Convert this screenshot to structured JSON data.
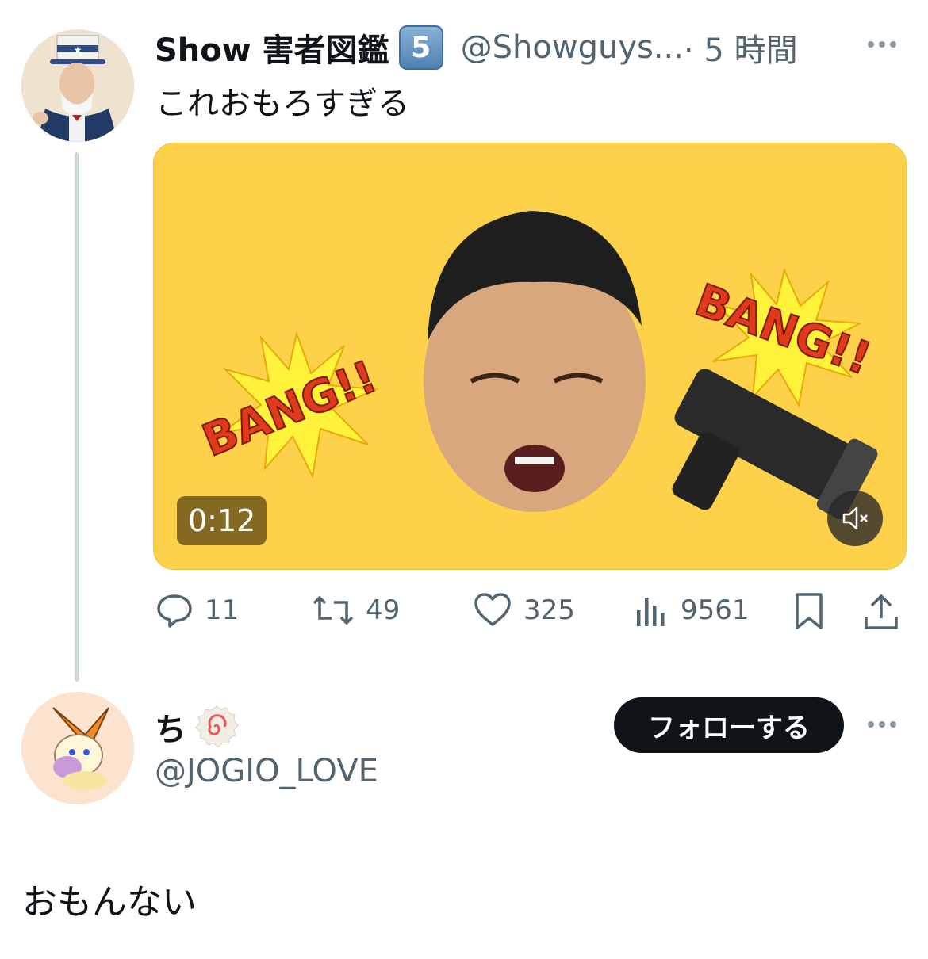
{
  "tweet": {
    "author_name": "Show 害者図鑑",
    "badge": "5",
    "handle": "@Showguys...",
    "time": "· 5 時間",
    "text": "これおもろすぎる",
    "video": {
      "duration": "0:12",
      "overlay_words": [
        "BANG!!",
        "BANG!!"
      ],
      "background_color": "#fdd24a"
    },
    "actions": {
      "replies": "11",
      "retweets": "49",
      "likes": "325",
      "views": "9561"
    }
  },
  "reply": {
    "author_name": "ち",
    "handle": "@JOGIO_LOVE",
    "follow_label": "フォローする",
    "text": "おもんない"
  },
  "icons": [
    "more-icon",
    "mute-icon",
    "reply-icon",
    "retweet-icon",
    "like-icon",
    "views-icon",
    "bookmark-icon",
    "share-icon",
    "naruto-icon"
  ]
}
